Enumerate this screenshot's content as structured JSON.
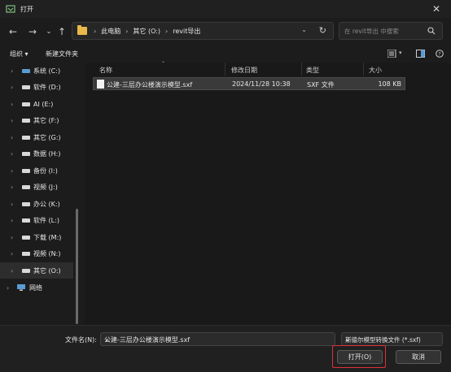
{
  "window": {
    "title": "打开"
  },
  "address": {
    "crumbs": [
      "此电脑",
      "其它 (O:)",
      "revit导出"
    ]
  },
  "search": {
    "placeholder": "在 revit导出 中搜索"
  },
  "toolbar": {
    "organize": "组织 ▾",
    "new_folder": "新建文件夹"
  },
  "sidebar": {
    "items": [
      {
        "label": "系统 (C:)",
        "icon": "drive-c-icon"
      },
      {
        "label": "软件 (D:)",
        "icon": "drive-icon"
      },
      {
        "label": "AI (E:)",
        "icon": "drive-icon"
      },
      {
        "label": "其它 (F:)",
        "icon": "drive-icon"
      },
      {
        "label": "其它 (G:)",
        "icon": "drive-icon"
      },
      {
        "label": "数据 (H:)",
        "icon": "drive-icon"
      },
      {
        "label": "备份 (I:)",
        "icon": "drive-icon"
      },
      {
        "label": "视频 (J:)",
        "icon": "drive-icon"
      },
      {
        "label": "办公 (K:)",
        "icon": "drive-icon"
      },
      {
        "label": "软件 (L:)",
        "icon": "drive-icon"
      },
      {
        "label": "下载 (M:)",
        "icon": "drive-icon"
      },
      {
        "label": "视频 (N:)",
        "icon": "drive-icon"
      },
      {
        "label": "其它 (O:)",
        "icon": "drive-icon",
        "selected": true
      },
      {
        "label": "网络",
        "icon": "network-icon"
      }
    ]
  },
  "columns": {
    "name": "名称",
    "modified": "修改日期",
    "type": "类型",
    "size": "大小"
  },
  "files": [
    {
      "name": "公建-三层办公楼演示模型.sxf",
      "modified": "2024/11/28 10:38",
      "type": "SXF 文件",
      "size": "108 KB"
    }
  ],
  "footer": {
    "filename_label": "文件名(N):",
    "filename_value": "公建-三层办公楼演示模型.sxf",
    "filetype": "斯德尔模型转换文件 (*.sxf)",
    "open": "打开(O)",
    "cancel": "取消"
  },
  "colors": {
    "highlight": "#e0303a",
    "folder": "#e8b84a"
  }
}
